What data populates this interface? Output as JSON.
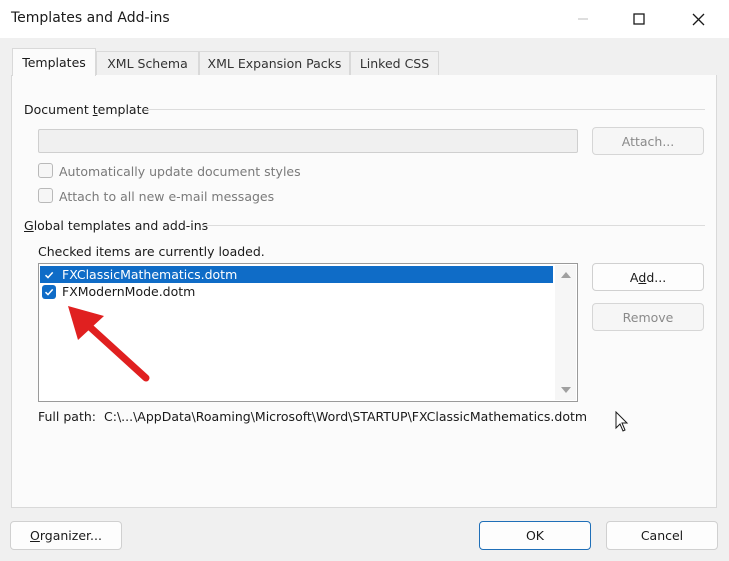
{
  "window": {
    "title": "Templates and Add-ins",
    "icons": [
      "minimize-icon",
      "maximize-icon",
      "close-icon"
    ]
  },
  "tabs": [
    {
      "label": "Templates",
      "active": true
    },
    {
      "label": "XML Schema",
      "active": false
    },
    {
      "label": "XML Expansion Packs",
      "active": false
    },
    {
      "label": "Linked CSS",
      "active": false
    }
  ],
  "document_template": {
    "group_label_pre": "Document ",
    "group_label_ul": "t",
    "group_label_post": "emplate",
    "path_value": "",
    "attach_label": "Attach...",
    "auto_update_label": "Automatically update document styles",
    "attach_all_label": "Attach to all new e-mail messages"
  },
  "global": {
    "group_label_pre": "",
    "group_label_ul": "G",
    "group_label_post": "lobal templates and add-ins",
    "hint": "Checked items are currently loaded.",
    "items": [
      {
        "label": "FXClassicMathematics.dotm",
        "checked": true,
        "selected": true
      },
      {
        "label": "FXModernMode.dotm",
        "checked": true,
        "selected": false
      }
    ],
    "add_pre": "A",
    "add_ul": "d",
    "add_post": "d...",
    "remove_label": "Remove",
    "full_path_label": "Full path:",
    "full_path_value": "C:\\...\\AppData\\Roaming\\Microsoft\\Word\\STARTUP\\FXClassicMathematics.dotm"
  },
  "footer": {
    "organizer_pre": "",
    "organizer_ul": "O",
    "organizer_post": "rganizer...",
    "ok_label": "OK",
    "cancel_label": "Cancel"
  },
  "colors": {
    "accent": "#0f6cc7",
    "annotation_arrow": "#e02020"
  }
}
